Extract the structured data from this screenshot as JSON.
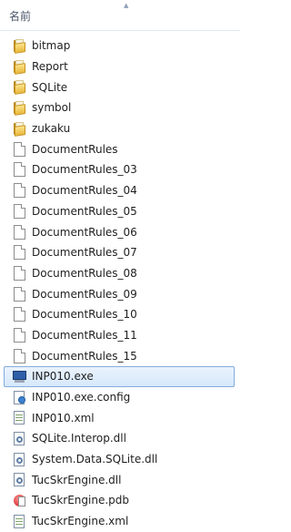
{
  "header": {
    "column_label": "名前"
  },
  "files": [
    {
      "name": "bitmap",
      "icon": "folder-icon"
    },
    {
      "name": "Report",
      "icon": "folder-icon"
    },
    {
      "name": "SQLite",
      "icon": "folder-icon"
    },
    {
      "name": "symbol",
      "icon": "folder-icon"
    },
    {
      "name": "zukaku",
      "icon": "folder-icon"
    },
    {
      "name": "DocumentRules",
      "icon": "file-icon"
    },
    {
      "name": "DocumentRules_03",
      "icon": "file-icon"
    },
    {
      "name": "DocumentRules_04",
      "icon": "file-icon"
    },
    {
      "name": "DocumentRules_05",
      "icon": "file-icon"
    },
    {
      "name": "DocumentRules_06",
      "icon": "file-icon"
    },
    {
      "name": "DocumentRules_07",
      "icon": "file-icon"
    },
    {
      "name": "DocumentRules_08",
      "icon": "file-icon"
    },
    {
      "name": "DocumentRules_09",
      "icon": "file-icon"
    },
    {
      "name": "DocumentRules_10",
      "icon": "file-icon"
    },
    {
      "name": "DocumentRules_11",
      "icon": "file-icon"
    },
    {
      "name": "DocumentRules_15",
      "icon": "file-icon"
    },
    {
      "name": "INP010.exe",
      "icon": "exe-icon",
      "selected": true
    },
    {
      "name": "INP010.exe.config",
      "icon": "config-icon"
    },
    {
      "name": "INP010.xml",
      "icon": "xml-icon"
    },
    {
      "name": "SQLite.Interop.dll",
      "icon": "dll-icon"
    },
    {
      "name": "System.Data.SQLite.dll",
      "icon": "dll-icon"
    },
    {
      "name": "TucSkrEngine.dll",
      "icon": "dll-icon"
    },
    {
      "name": "TucSkrEngine.pdb",
      "icon": "pdb-icon"
    },
    {
      "name": "TucSkrEngine.xml",
      "icon": "xml-icon"
    }
  ]
}
